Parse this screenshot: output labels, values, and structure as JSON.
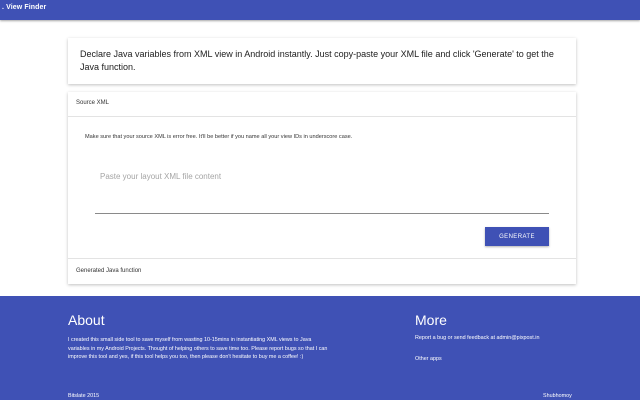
{
  "header": {
    "title": ". View Finder"
  },
  "intro": {
    "text": "Declare Java variables from XML view in Android instantly. Just copy-paste your XML file and click 'Generate' to get the Java function."
  },
  "source": {
    "header": "Source XML",
    "hint": "Make sure that your source XML is error free. It'll be better if you name all your view IDs in underscore case.",
    "placeholder": "Paste your layout XML file content",
    "value": "",
    "generate_label": "GENERATE"
  },
  "output": {
    "header": "Generated Java function"
  },
  "footer": {
    "about_title": "About",
    "about_text": "I created this small side tool to save myself from wasting 10-15mins in instantiating XML views to Java variables in my Android Projects. Thought of helping others to save time too. Please report bugs so that I can improve this tool and yes, if this tool helps you too, then please don't hesitate to buy me a coffee! :)",
    "more_title": "More",
    "more_link": "Report a bug or send feedback at admin@pixpost.in",
    "other_apps": "Other apps",
    "copyright": "Bitslate 2015",
    "author": "Shubhomoy"
  },
  "colors": {
    "primary": "#3f51b5",
    "text": "#212121",
    "placeholder": "#a5a5a5"
  }
}
